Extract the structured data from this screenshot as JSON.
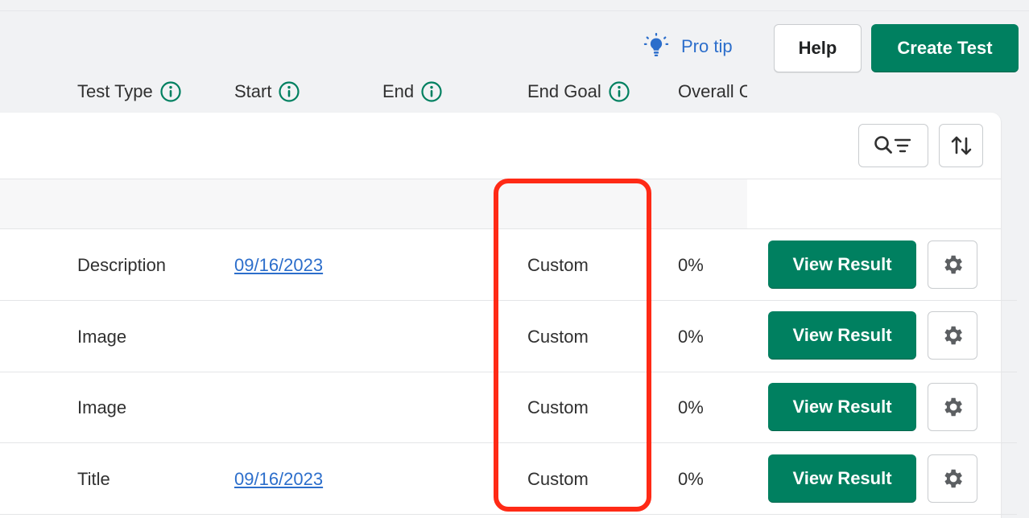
{
  "header": {
    "pro_tip_label": "Pro tip",
    "help_label": "Help",
    "create_test_label": "Create Test"
  },
  "table": {
    "columns": {
      "test_type": "Test Type",
      "start": "Start",
      "end": "End",
      "end_goal": "End Goal",
      "overall": "Overall C"
    },
    "rows": [
      {
        "test_type": "Description",
        "start": "09/16/2023",
        "end": "",
        "end_goal": "Custom",
        "overall": "0%",
        "action": "View Result"
      },
      {
        "test_type": "Image",
        "start": "",
        "end": "",
        "end_goal": "Custom",
        "overall": "0%",
        "action": "View Result"
      },
      {
        "test_type": "Image",
        "start": "",
        "end": "",
        "end_goal": "Custom",
        "overall": "0%",
        "action": "View Result"
      },
      {
        "test_type": "Title",
        "start": "09/16/2023",
        "end": "",
        "end_goal": "Custom",
        "overall": "0%",
        "action": "View Result"
      }
    ]
  },
  "icons": {
    "pro_tip": "lightbulb-icon",
    "search_filter": "search-filter-icon",
    "sort": "sort-arrows-icon",
    "info": "info-icon",
    "gear": "gear-icon"
  },
  "colors": {
    "primary_green": "#008060",
    "link_blue": "#2c6ecb",
    "highlight_red": "#ff2a16",
    "page_bg": "#f1f2f4"
  }
}
